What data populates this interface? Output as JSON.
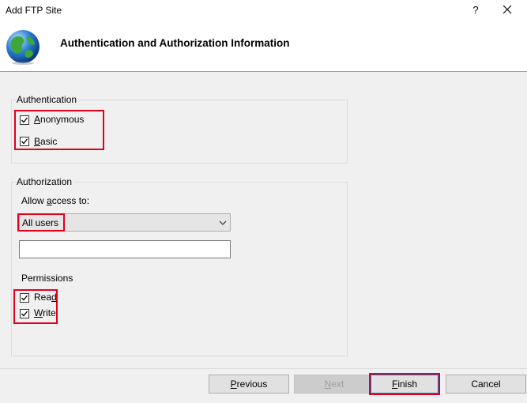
{
  "window": {
    "title": "Add FTP Site",
    "help": "?"
  },
  "header": {
    "title": "Authentication and Authorization Information",
    "icon": "globe-icon"
  },
  "authentication": {
    "legend": "Authentication",
    "anonymous": {
      "pre": "",
      "mnemonic": "A",
      "post": "nonymous",
      "checked": true
    },
    "basic": {
      "pre": "",
      "mnemonic": "B",
      "post": "asic",
      "checked": true
    }
  },
  "authorization": {
    "legend": "Authorization",
    "allow_label": {
      "pre": "Allow ",
      "mnemonic": "a",
      "post": "ccess to:"
    },
    "allow_value": "All users",
    "extra_value": "",
    "permissions_label": "Permissions",
    "read": {
      "pre": "Rea",
      "mnemonic": "d",
      "post": "",
      "checked": true
    },
    "write": {
      "pre": "",
      "mnemonic": "W",
      "post": "rite",
      "checked": true
    }
  },
  "footer": {
    "previous": {
      "pre": "",
      "mnemonic": "P",
      "post": "revious"
    },
    "next": {
      "pre": "",
      "mnemonic": "N",
      "post": "ext"
    },
    "finish": {
      "pre": "",
      "mnemonic": "F",
      "post": "inish"
    },
    "cancel": "Cancel"
  },
  "colors": {
    "highlight": "#e3001b",
    "accent": "#0078d7"
  }
}
